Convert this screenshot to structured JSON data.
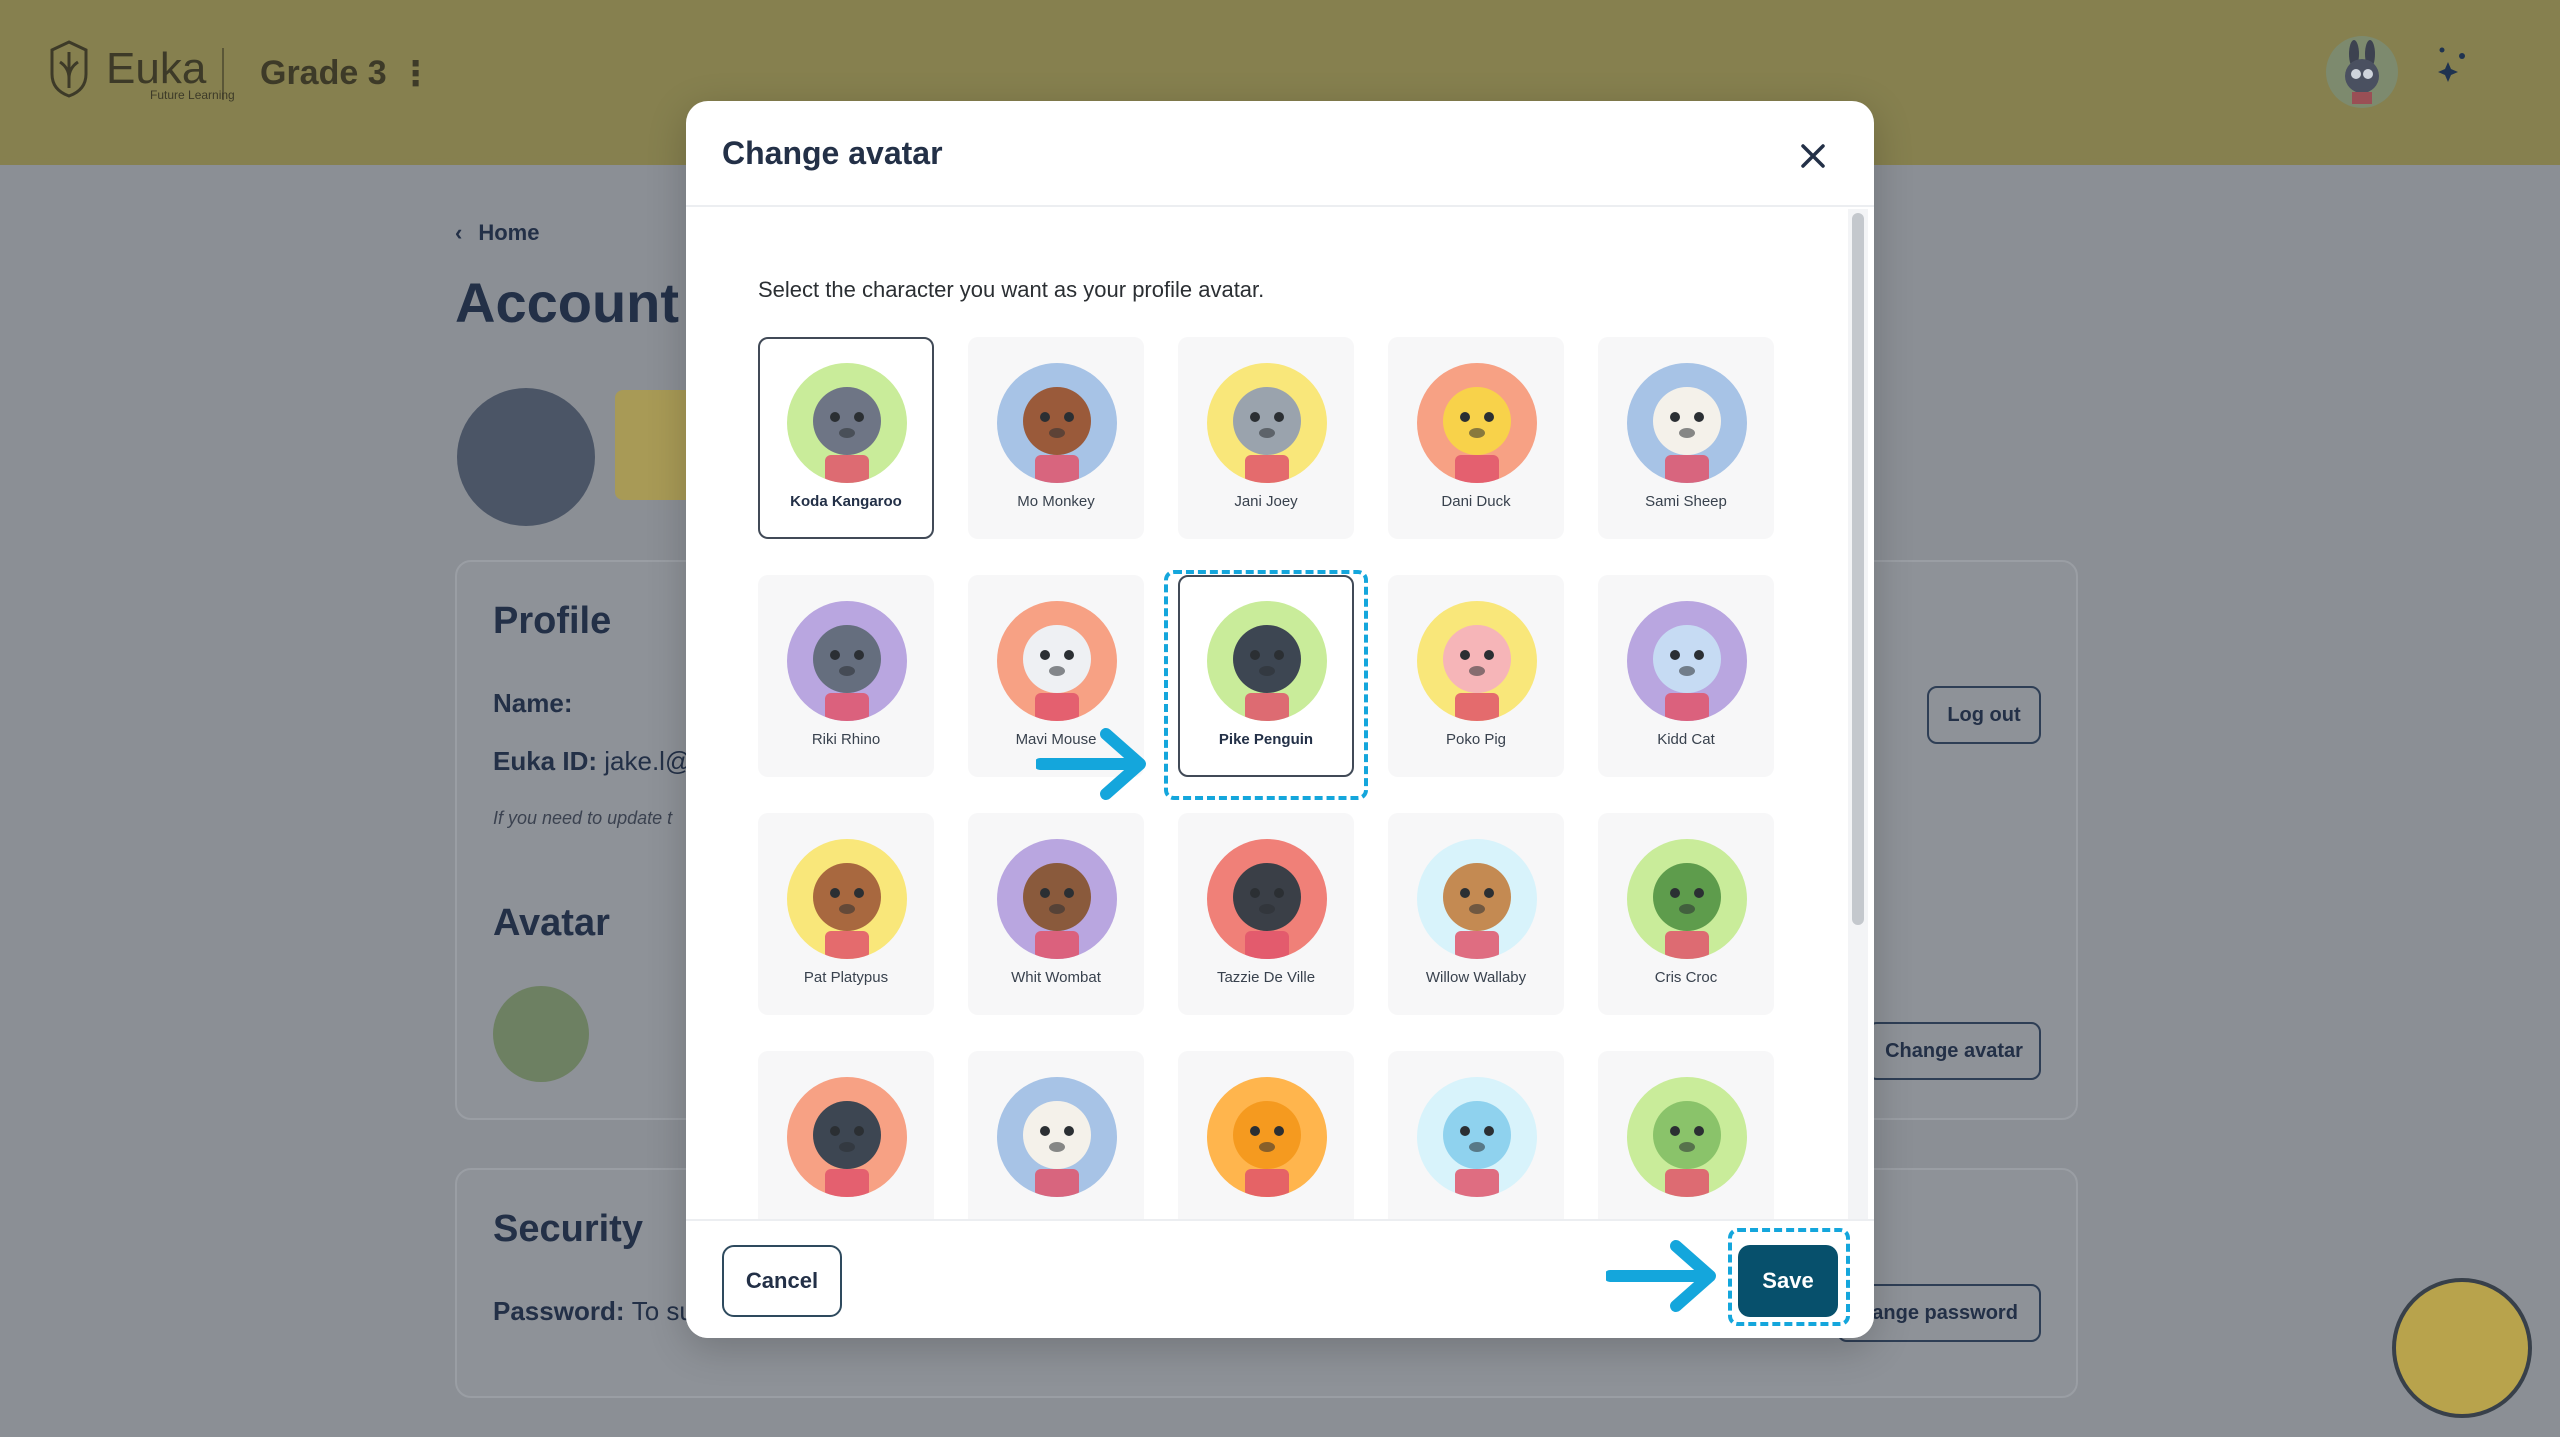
{
  "header": {
    "brand": "Euka",
    "brand_sub": "Future Learning",
    "grade": "Grade 3"
  },
  "page": {
    "breadcrumb": "Home",
    "title": "Account",
    "profile_heading": "Profile",
    "name_label": "Name:",
    "euka_id_label": "Euka ID:",
    "euka_id_value": "jake.l@e",
    "update_note": "If you need to update t",
    "logout": "Log out",
    "avatar_heading": "Avatar",
    "change_avatar": "Change avatar",
    "security_heading": "Security",
    "password_label": "Password:",
    "password_value": "To su",
    "change_password": "hange password"
  },
  "modal": {
    "title": "Change avatar",
    "instruction": "Select the character you want as your profile avatar.",
    "cancel": "Cancel",
    "save": "Save",
    "selected_avatar": "Koda Kangaroo",
    "highlighted_avatar": "Pike Penguin",
    "avatars": [
      {
        "name": "Koda Kangaroo",
        "bg": "#c9ec9a",
        "fg": "#6e7585"
      },
      {
        "name": "Mo Monkey",
        "bg": "#a7c3e6",
        "fg": "#9a5a3a"
      },
      {
        "name": "Jani Joey",
        "bg": "#f9e77a",
        "fg": "#9aa3ad"
      },
      {
        "name": "Dani Duck",
        "bg": "#f7a184",
        "fg": "#f8d24a"
      },
      {
        "name": "Sami Sheep",
        "bg": "#a7c3e6",
        "fg": "#f4f1ea"
      },
      {
        "name": "Riki Rhino",
        "bg": "#b9a6e0",
        "fg": "#656e7e"
      },
      {
        "name": "Mavi Mouse",
        "bg": "#f7a184",
        "fg": "#eef0f3"
      },
      {
        "name": "Pike Penguin",
        "bg": "#c9ec9a",
        "fg": "#3d4652"
      },
      {
        "name": "Poko Pig",
        "bg": "#f9e77a",
        "fg": "#f6b5b8"
      },
      {
        "name": "Kidd Cat",
        "bg": "#b9a6e0",
        "fg": "#c6dbf3"
      },
      {
        "name": "Pat Platypus",
        "bg": "#f9e77a",
        "fg": "#a8683f"
      },
      {
        "name": "Whit Wombat",
        "bg": "#b9a6e0",
        "fg": "#8a5a3c"
      },
      {
        "name": "Tazzie De Ville",
        "bg": "#f08078",
        "fg": "#3a3f47"
      },
      {
        "name": "Willow Wallaby",
        "bg": "#d8f3fb",
        "fg": "#c48a52"
      },
      {
        "name": "Cris Croc",
        "bg": "#c9ec9a",
        "fg": "#5e9c4c"
      },
      {
        "name": "",
        "bg": "#f7a184",
        "fg": "#3d4652"
      },
      {
        "name": "",
        "bg": "#a7c3e6",
        "fg": "#f4f1ea"
      },
      {
        "name": "",
        "bg": "#ffb54d",
        "fg": "#f59a1f"
      },
      {
        "name": "",
        "bg": "#d8f3fb",
        "fg": "#8fd2ee"
      },
      {
        "name": "",
        "bg": "#c9ec9a",
        "fg": "#8ac36a"
      }
    ]
  },
  "colors": {
    "primary": "#07506c",
    "annotation": "#14a6dc",
    "header_bg": "#86804f"
  }
}
